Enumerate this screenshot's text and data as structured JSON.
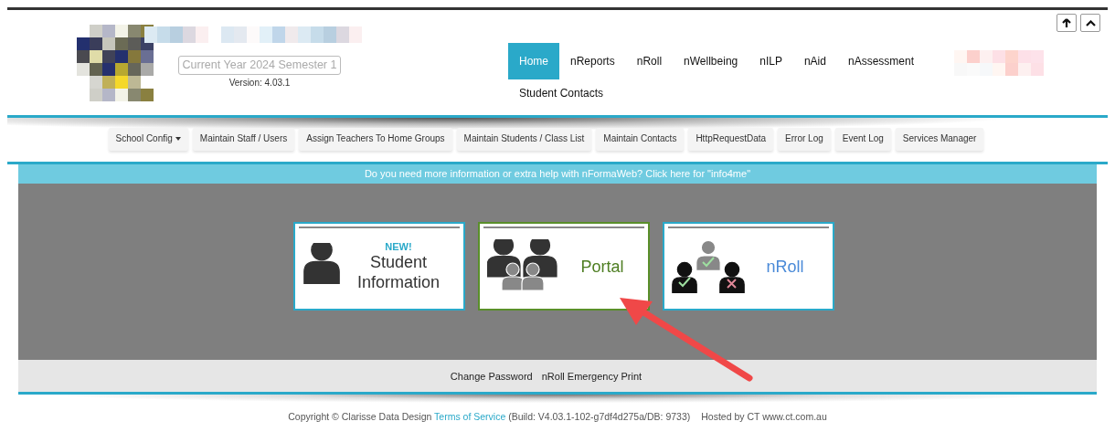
{
  "header": {
    "term": "Current Year 2024 Semester 1",
    "version": "Version: 4.03.1"
  },
  "top_buttons": [
    {
      "kind": "arrow-up"
    },
    {
      "kind": "chevron-up"
    }
  ],
  "nav": [
    {
      "label": "Home",
      "selected": true
    },
    {
      "label": "nReports",
      "selected": false
    },
    {
      "label": "nRoll",
      "selected": false
    },
    {
      "label": "nWellbeing",
      "selected": false
    },
    {
      "label": "nILP",
      "selected": false
    },
    {
      "label": "nAid",
      "selected": false
    },
    {
      "label": "nAssessment",
      "selected": false
    },
    {
      "label": "Student Contacts",
      "selected": false
    }
  ],
  "submenu": [
    {
      "label": "School Config",
      "dropdown": true
    },
    {
      "label": "Maintain Staff / Users",
      "dropdown": false
    },
    {
      "label": "Assign Teachers To Home Groups",
      "dropdown": false
    },
    {
      "label": "Maintain Students / Class List",
      "dropdown": false
    },
    {
      "label": "Maintain Contacts",
      "dropdown": false
    },
    {
      "label": "HttpRequestData",
      "dropdown": false
    },
    {
      "label": "Error Log",
      "dropdown": false
    },
    {
      "label": "Event Log",
      "dropdown": false
    },
    {
      "label": "Services Manager",
      "dropdown": false
    }
  ],
  "info_banner": "Do you need more information or extra help with nFormaWeb? Click here for \"info4me\"",
  "tiles": [
    {
      "kind": "student",
      "badge": "NEW!",
      "label": "Student Information",
      "color": "#2aa9c9"
    },
    {
      "kind": "portal",
      "label": "Portal",
      "color": "#5a8f2a"
    },
    {
      "kind": "roll",
      "label": "nRoll",
      "color": "#2aa9c9"
    }
  ],
  "footer_links": [
    "Change Password",
    "nRoll Emergency Print"
  ],
  "copyright": {
    "prefix": "Copyright © Clarisse Data Design",
    "link": "Terms of Service",
    "build": "(Build: V4.03.1-102-g7df4d275a/DB: 9733)",
    "hosted": "Hosted by CT www.ct.com.au"
  }
}
